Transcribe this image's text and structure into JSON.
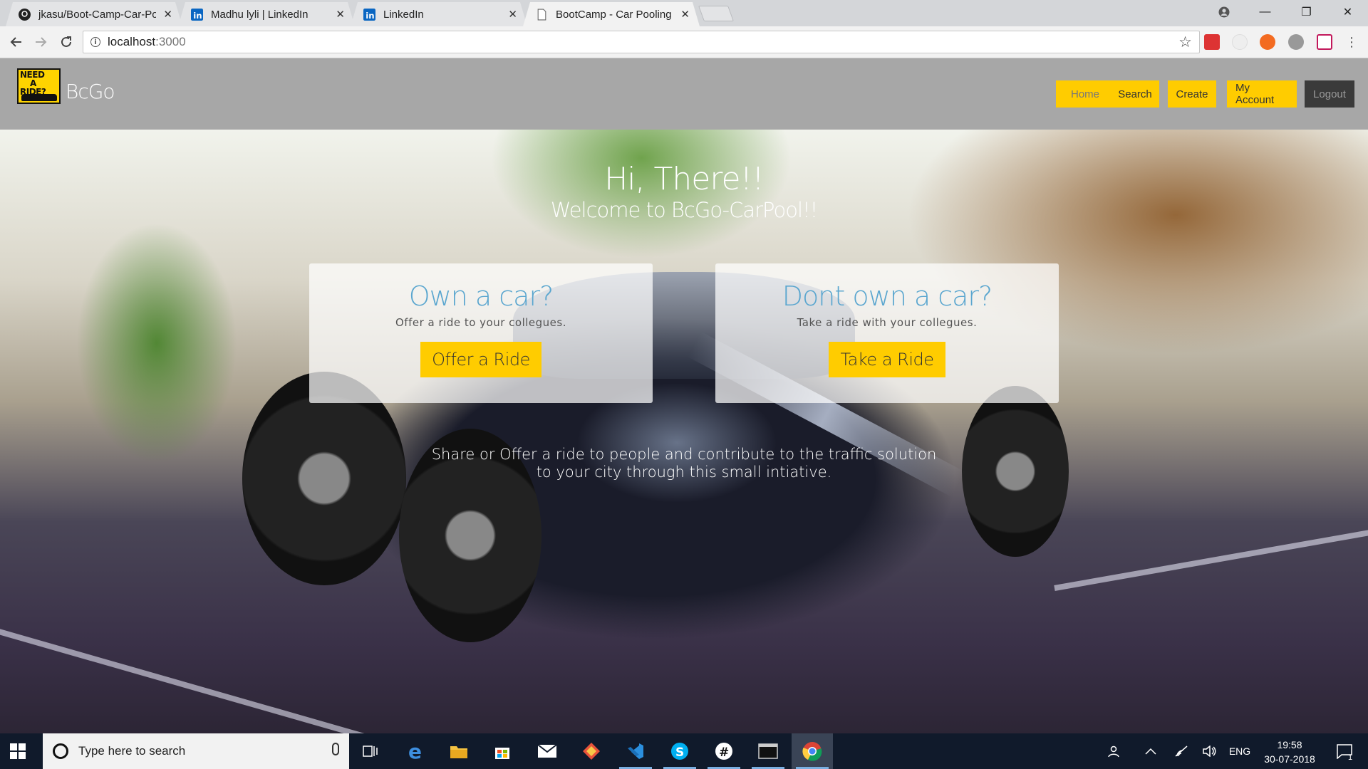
{
  "browser": {
    "tabs": [
      {
        "title": "jkasu/Boot-Camp-Car-Po",
        "icon": "github-icon",
        "active": false
      },
      {
        "title": "Madhu lyli | LinkedIn",
        "icon": "linkedin-icon",
        "active": false
      },
      {
        "title": "LinkedIn",
        "icon": "linkedin-icon",
        "active": false
      },
      {
        "title": "BootCamp - Car Pooling",
        "icon": "page-icon",
        "active": true
      }
    ],
    "tab_close": "✕",
    "address": {
      "host": "localhost",
      "port": ":3000"
    },
    "window_controls": {
      "minimize": "—",
      "maximize": "❐",
      "close": "✕"
    }
  },
  "site": {
    "logo_text": [
      "NEED",
      "A",
      "RIDE?"
    ],
    "brand": "BcGo",
    "nav": {
      "home": "Home",
      "search": "Search",
      "create": "Create",
      "account": "My Account",
      "logout": "Logout"
    },
    "hero": {
      "title": "Hi, There!!",
      "subtitle": "Welcome to BcGo-CarPool!!",
      "cards": [
        {
          "heading": "Own a car?",
          "text": "Offer a ride to your collegues.",
          "button": "Offer a Ride"
        },
        {
          "heading": "Dont own a car?",
          "text": "Take a ride with your collegues.",
          "button": "Take a Ride"
        }
      ],
      "tagline_line1": "Share or Offer a ride to people and contribute to the traffic solution",
      "tagline_line2": "to your city through this small intiative."
    }
  },
  "taskbar": {
    "search_placeholder": "Type here to search",
    "language": "ENG",
    "time": "19:58",
    "date": "30-07-2018",
    "notification_count": "1"
  },
  "colors": {
    "accent_yellow": "#ffcc00",
    "header_gray": "#a7a7a7",
    "card_heading_blue": "#5aa6cf",
    "logout_dark": "#3a3a3a"
  }
}
